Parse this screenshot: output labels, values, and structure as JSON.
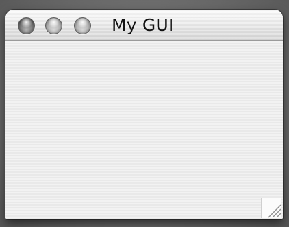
{
  "window": {
    "title": "My GUI",
    "controls": [
      {
        "name": "close-button",
        "icon": "circle-button-icon"
      },
      {
        "name": "minimize-button",
        "icon": "circle-button-icon"
      },
      {
        "name": "zoom-button",
        "icon": "circle-button-icon"
      }
    ],
    "resize_grip_icon": "resize-grip-icon"
  }
}
